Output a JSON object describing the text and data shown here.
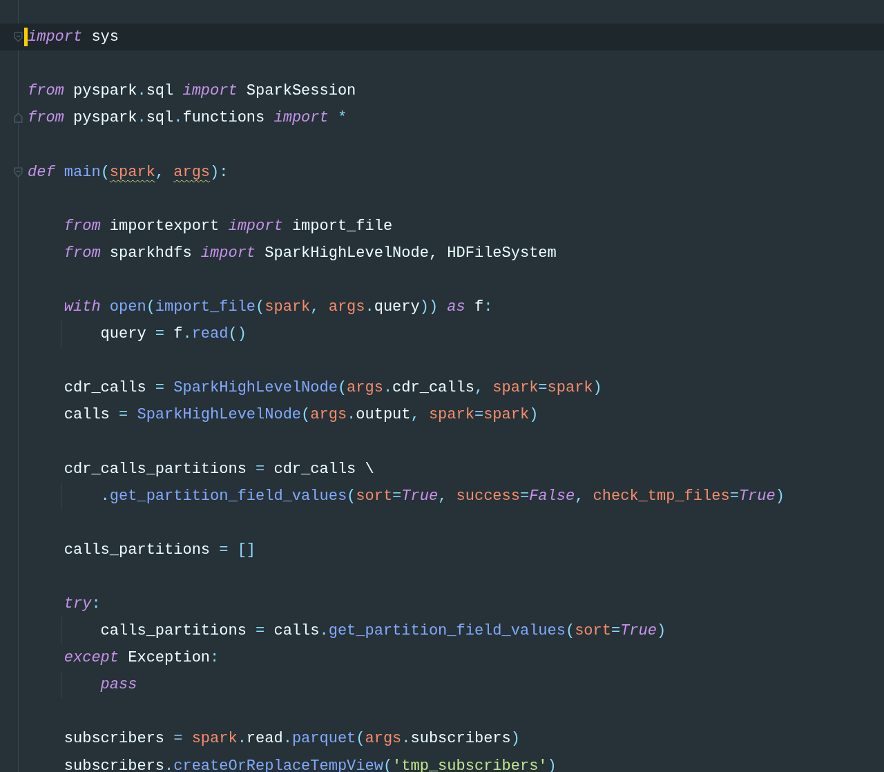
{
  "editor": {
    "lines": [
      {
        "kind": "fold_start",
        "current": true,
        "tokens": [
          {
            "text": "import",
            "kind": "kw"
          },
          {
            "text": " sys",
            "kind": "plain"
          }
        ]
      },
      {
        "kind": "plain",
        "current": false
      },
      {
        "kind": "plain",
        "current": false,
        "tokens": [
          {
            "text": "from",
            "kind": "kw"
          },
          {
            "text": " pyspark",
            "kind": "plain"
          },
          {
            "text": ".",
            "kind": "punct"
          },
          {
            "text": "sql ",
            "kind": "plain"
          },
          {
            "text": "import",
            "kind": "kw"
          },
          {
            "text": " SparkSession",
            "kind": "plain"
          }
        ]
      },
      {
        "kind": "fold_end",
        "current": false,
        "tokens": [
          {
            "text": "from",
            "kind": "kw"
          },
          {
            "text": " pyspark",
            "kind": "plain"
          },
          {
            "text": ".",
            "kind": "punct"
          },
          {
            "text": "sql",
            "kind": "plain"
          },
          {
            "text": ".",
            "kind": "punct"
          },
          {
            "text": "functions ",
            "kind": "plain"
          },
          {
            "text": "import",
            "kind": "kw"
          },
          {
            "text": " *",
            "kind": "punct"
          }
        ]
      },
      {
        "kind": "plain",
        "current": false
      },
      {
        "kind": "fold_start",
        "current": false,
        "tokens": [
          {
            "text": "def",
            "kind": "kw"
          },
          {
            "text": " main",
            "kind": "fn"
          },
          {
            "text": "(",
            "kind": "punct"
          },
          {
            "text": "spark",
            "kind": "param",
            "warning": true
          },
          {
            "text": ", ",
            "kind": "punct"
          },
          {
            "text": "args",
            "kind": "param",
            "warning": true
          },
          {
            "text": "):",
            "kind": "punct"
          }
        ]
      },
      {
        "kind": "plain",
        "current": false
      },
      {
        "kind": "plain",
        "current": false,
        "tokens": [
          {
            "text": "    from",
            "kind": "kw"
          },
          {
            "text": " importexport ",
            "kind": "plain"
          },
          {
            "text": "import",
            "kind": "kw"
          },
          {
            "text": " import_file",
            "kind": "plain"
          }
        ]
      },
      {
        "kind": "plain",
        "current": false,
        "tokens": [
          {
            "text": "    from",
            "kind": "kw"
          },
          {
            "text": " sparkhdfs ",
            "kind": "plain"
          },
          {
            "text": "import",
            "kind": "kw"
          },
          {
            "text": " SparkHighLevelNode, HDFileSystem",
            "kind": "plain"
          }
        ]
      },
      {
        "kind": "plain",
        "current": false
      },
      {
        "kind": "plain",
        "current": false,
        "tokens": [
          {
            "text": "    with",
            "kind": "kw"
          },
          {
            "text": " open",
            "kind": "fn"
          },
          {
            "text": "(",
            "kind": "punct"
          },
          {
            "text": "import_file",
            "kind": "fn"
          },
          {
            "text": "(",
            "kind": "punct"
          },
          {
            "text": "spark",
            "kind": "param"
          },
          {
            "text": ", ",
            "kind": "punct"
          },
          {
            "text": "args",
            "kind": "param"
          },
          {
            "text": ".",
            "kind": "punct"
          },
          {
            "text": "query",
            "kind": "plain"
          },
          {
            "text": ")) ",
            "kind": "punct"
          },
          {
            "text": "as",
            "kind": "kw"
          },
          {
            "text": " f",
            "kind": "plain"
          },
          {
            "text": ":",
            "kind": "punct"
          }
        ]
      },
      {
        "kind": "plain",
        "current": false,
        "tokens": [
          {
            "text": "        query ",
            "kind": "plain"
          },
          {
            "text": "=",
            "kind": "punct"
          },
          {
            "text": " f",
            "kind": "plain"
          },
          {
            "text": ".",
            "kind": "punct"
          },
          {
            "text": "read",
            "kind": "fn"
          },
          {
            "text": "()",
            "kind": "punct"
          }
        ]
      },
      {
        "kind": "plain",
        "current": false
      },
      {
        "kind": "plain",
        "current": false,
        "tokens": [
          {
            "text": "    cdr_calls ",
            "kind": "plain"
          },
          {
            "text": "=",
            "kind": "punct"
          },
          {
            "text": " SparkHighLevelNode",
            "kind": "fn"
          },
          {
            "text": "(",
            "kind": "punct"
          },
          {
            "text": "args",
            "kind": "param"
          },
          {
            "text": ".",
            "kind": "punct"
          },
          {
            "text": "cdr_calls",
            "kind": "plain"
          },
          {
            "text": ", ",
            "kind": "punct"
          },
          {
            "text": "spark",
            "kind": "param"
          },
          {
            "text": "=",
            "kind": "punct"
          },
          {
            "text": "spark",
            "kind": "param"
          },
          {
            "text": ")",
            "kind": "punct"
          }
        ]
      },
      {
        "kind": "plain",
        "current": false,
        "tokens": [
          {
            "text": "    calls ",
            "kind": "plain"
          },
          {
            "text": "=",
            "kind": "punct"
          },
          {
            "text": " SparkHighLevelNode",
            "kind": "fn"
          },
          {
            "text": "(",
            "kind": "punct"
          },
          {
            "text": "args",
            "kind": "param"
          },
          {
            "text": ".",
            "kind": "punct"
          },
          {
            "text": "output",
            "kind": "plain"
          },
          {
            "text": ", ",
            "kind": "punct"
          },
          {
            "text": "spark",
            "kind": "param"
          },
          {
            "text": "=",
            "kind": "punct"
          },
          {
            "text": "spark",
            "kind": "param"
          },
          {
            "text": ")",
            "kind": "punct"
          }
        ]
      },
      {
        "kind": "plain",
        "current": false
      },
      {
        "kind": "plain",
        "current": false,
        "tokens": [
          {
            "text": "    cdr_calls_partitions ",
            "kind": "plain"
          },
          {
            "text": "=",
            "kind": "punct"
          },
          {
            "text": " cdr_calls \\",
            "kind": "plain"
          }
        ]
      },
      {
        "kind": "plain",
        "current": false,
        "tokens": [
          {
            "text": "        .",
            "kind": "punct"
          },
          {
            "text": "get_partition_field_values",
            "kind": "fn"
          },
          {
            "text": "(",
            "kind": "punct"
          },
          {
            "text": "sort",
            "kind": "param"
          },
          {
            "text": "=",
            "kind": "punct"
          },
          {
            "text": "True",
            "kind": "const"
          },
          {
            "text": ", ",
            "kind": "punct"
          },
          {
            "text": "success",
            "kind": "param"
          },
          {
            "text": "=",
            "kind": "punct"
          },
          {
            "text": "False",
            "kind": "const"
          },
          {
            "text": ", ",
            "kind": "punct"
          },
          {
            "text": "check_tmp_files",
            "kind": "param"
          },
          {
            "text": "=",
            "kind": "punct"
          },
          {
            "text": "True",
            "kind": "const"
          },
          {
            "text": ")",
            "kind": "punct"
          }
        ]
      },
      {
        "kind": "plain",
        "current": false
      },
      {
        "kind": "plain",
        "current": false,
        "tokens": [
          {
            "text": "    calls_partitions ",
            "kind": "plain"
          },
          {
            "text": "=",
            "kind": "punct"
          },
          {
            "text": " []",
            "kind": "punct"
          }
        ]
      },
      {
        "kind": "plain",
        "current": false
      },
      {
        "kind": "plain",
        "current": false,
        "tokens": [
          {
            "text": "    try",
            "kind": "kw"
          },
          {
            "text": ":",
            "kind": "punct"
          }
        ]
      },
      {
        "kind": "plain",
        "current": false,
        "tokens": [
          {
            "text": "        calls_partitions ",
            "kind": "plain"
          },
          {
            "text": "=",
            "kind": "punct"
          },
          {
            "text": " calls",
            "kind": "plain"
          },
          {
            "text": ".",
            "kind": "punct"
          },
          {
            "text": "get_partition_field_values",
            "kind": "fn"
          },
          {
            "text": "(",
            "kind": "punct"
          },
          {
            "text": "sort",
            "kind": "param"
          },
          {
            "text": "=",
            "kind": "punct"
          },
          {
            "text": "True",
            "kind": "const"
          },
          {
            "text": ")",
            "kind": "punct"
          }
        ]
      },
      {
        "kind": "plain",
        "current": false,
        "tokens": [
          {
            "text": "    except",
            "kind": "kw"
          },
          {
            "text": " Exception",
            "kind": "plain"
          },
          {
            "text": ":",
            "kind": "punct"
          }
        ]
      },
      {
        "kind": "plain",
        "current": false,
        "tokens": [
          {
            "text": "        pass",
            "kind": "kw"
          }
        ]
      },
      {
        "kind": "plain",
        "current": false
      },
      {
        "kind": "plain",
        "current": false,
        "tokens": [
          {
            "text": "    subscribers ",
            "kind": "plain"
          },
          {
            "text": "=",
            "kind": "punct"
          },
          {
            "text": " spark",
            "kind": "param"
          },
          {
            "text": ".",
            "kind": "punct"
          },
          {
            "text": "read",
            "kind": "plain"
          },
          {
            "text": ".",
            "kind": "punct"
          },
          {
            "text": "parquet",
            "kind": "fn"
          },
          {
            "text": "(",
            "kind": "punct"
          },
          {
            "text": "args",
            "kind": "param"
          },
          {
            "text": ".",
            "kind": "punct"
          },
          {
            "text": "subscribers",
            "kind": "plain"
          },
          {
            "text": ")",
            "kind": "punct"
          }
        ]
      },
      {
        "kind": "plain",
        "current": false,
        "tokens": [
          {
            "text": "    subscribers",
            "kind": "plain"
          },
          {
            "text": ".",
            "kind": "punct"
          },
          {
            "text": "createOrReplaceTempView",
            "kind": "fn"
          },
          {
            "text": "(",
            "kind": "punct"
          },
          {
            "text": "'tmp_subscribers'",
            "kind": "str"
          },
          {
            "text": ")",
            "kind": "punct"
          }
        ]
      }
    ]
  }
}
